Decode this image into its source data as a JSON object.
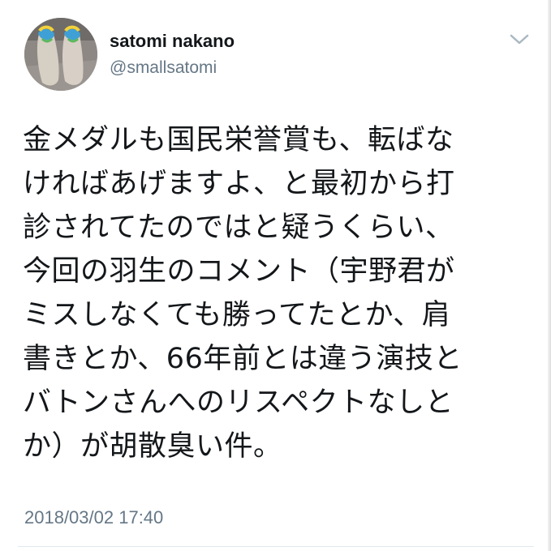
{
  "user": {
    "display_name": "satomi nakano",
    "handle": "@smallsatomi",
    "avatar": "feet-in-sandals-photo"
  },
  "tweet": {
    "lines": [
      "金メダルも国民栄誉賞も、転ばな",
      "ければあげますよ、と最初から打",
      "診されてたのではと疑うくらい、",
      "今回の羽生のコメント（宇野君が",
      "ミスしなくても勝ってたとか、肩",
      "書きとか、66年前とは違う演技と",
      "バトンさんへのリスペクトなしと",
      "か）が胡散臭い件。"
    ],
    "timestamp": "2018/03/02 17:40"
  },
  "icons": {
    "menu": "chevron-down-icon"
  },
  "colors": {
    "text": "#14171a",
    "secondary": "#657786",
    "caret": "#aab8c2",
    "divider": "#e1e8ed"
  }
}
